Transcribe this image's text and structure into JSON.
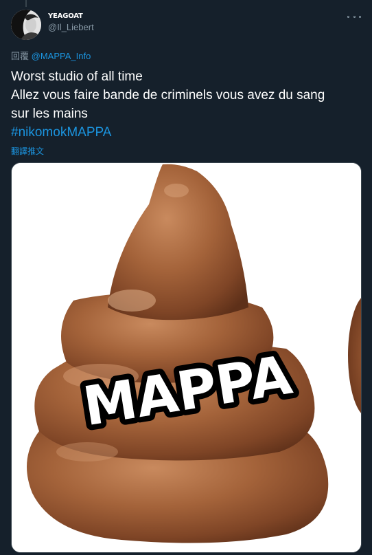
{
  "tweet": {
    "display_name": "YEAGOAT",
    "handle": "@Il_Liebert",
    "reply_prefix": "回覆",
    "reply_to": "@MAPPA_Info",
    "text_lines": [
      "Worst studio of all time",
      "Allez vous faire bande de criminels vous avez du sang",
      "sur les mains"
    ],
    "hashtag": "#nikomokMAPPA",
    "translate_label": "翻譯推文"
  },
  "media": {
    "overlay_text": "MAPPA",
    "icon": "poop-emoji-image"
  },
  "icons": {
    "more": "more-dots-icon"
  },
  "colors": {
    "background": "#15202b",
    "link": "#1b95e0",
    "secondary_text": "#8899a6",
    "border": "#38444d"
  }
}
